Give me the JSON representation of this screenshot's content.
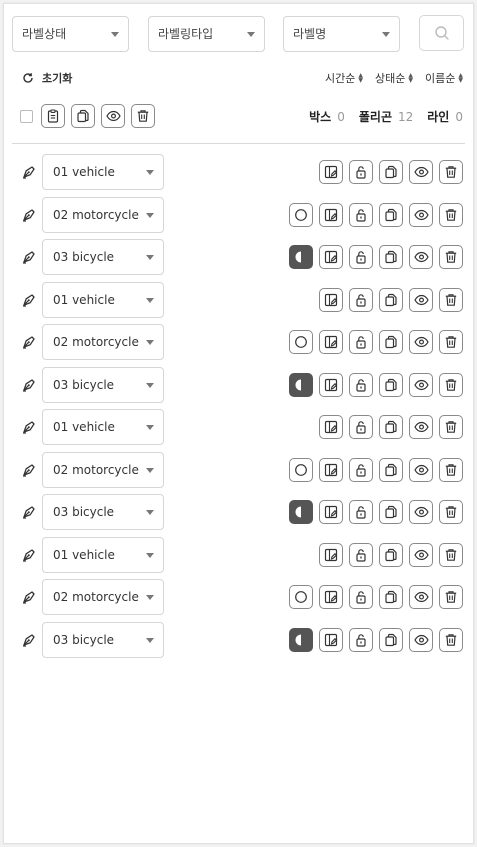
{
  "filters": {
    "label_status": "라벨상태",
    "labeling_type": "라벨링타입",
    "label_name": "라벨명"
  },
  "toolbar": {
    "reset_label": "초기화",
    "sort_time": "시간순",
    "sort_status": "상태순",
    "sort_name": "이름순"
  },
  "counts": {
    "box_label": "박스",
    "box_count": "0",
    "polygon_label": "폴리곤",
    "polygon_count": "12",
    "line_label": "라인",
    "line_count": "0"
  },
  "rows": [
    {
      "label": "01 vehicle",
      "shape": "none"
    },
    {
      "label": "02 motorcycle",
      "shape": "circle"
    },
    {
      "label": "03 bicycle",
      "shape": "half"
    },
    {
      "label": "01 vehicle",
      "shape": "none"
    },
    {
      "label": "02 motorcycle",
      "shape": "circle"
    },
    {
      "label": "03 bicycle",
      "shape": "half"
    },
    {
      "label": "01 vehicle",
      "shape": "none"
    },
    {
      "label": "02 motorcycle",
      "shape": "circle"
    },
    {
      "label": "03 bicycle",
      "shape": "half"
    },
    {
      "label": "01 vehicle",
      "shape": "none"
    },
    {
      "label": "02 motorcycle",
      "shape": "circle"
    },
    {
      "label": "03 bicycle",
      "shape": "half"
    }
  ],
  "icons": {
    "row_icons": [
      "pen-tool-icon",
      "circle-status-icon",
      "half-circle-status-icon",
      "edit-note-icon",
      "unlock-icon",
      "copy-icon",
      "eye-icon",
      "trash-icon"
    ],
    "toolbar_icons": [
      "clipboard-icon",
      "copy-icon",
      "eye-icon",
      "trash-icon",
      "refresh-icon",
      "search-icon"
    ]
  },
  "colors": {
    "accent_dark": "#555555",
    "border": "#d6d6d6",
    "muted_text": "#999999"
  }
}
